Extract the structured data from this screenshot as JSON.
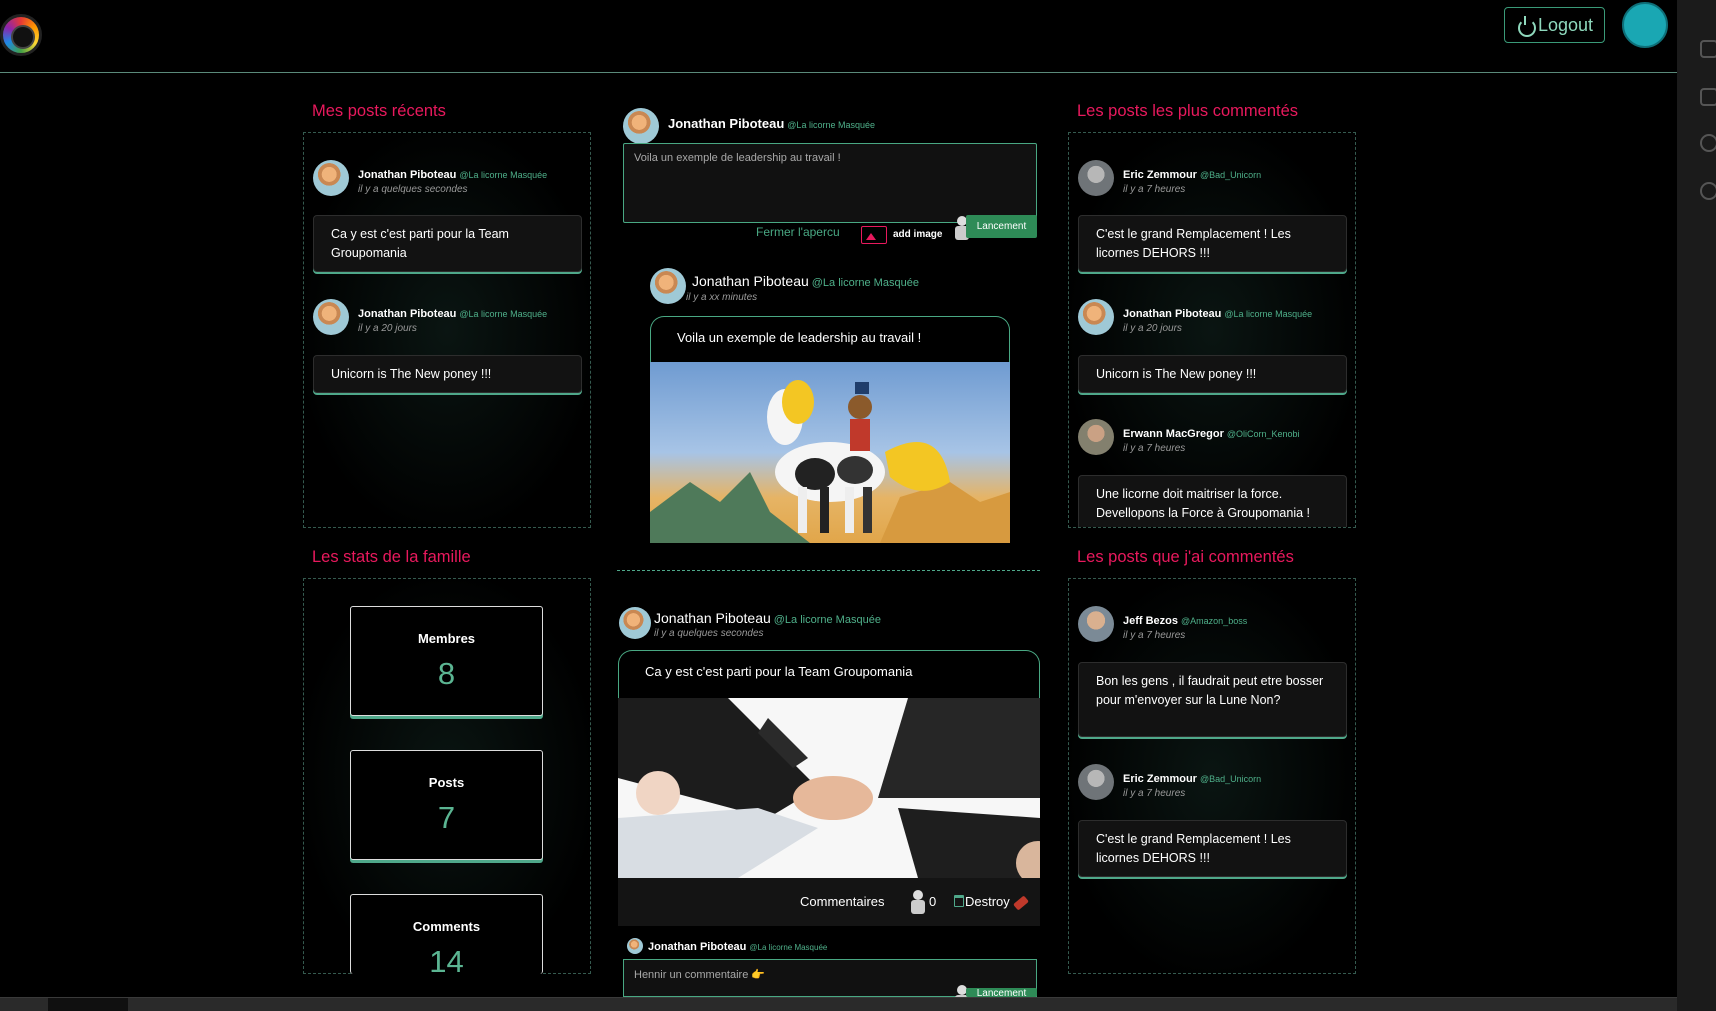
{
  "header": {
    "logout_label": "Logout"
  },
  "titles": {
    "recent": "Mes posts récents",
    "stats": "Les stats de la famille",
    "most_commented": "Les posts les plus commentés",
    "my_comments": "Les posts que j'ai commentés"
  },
  "recent_posts": [
    {
      "name": "Jonathan Piboteau",
      "handle": "@La licorne Masquée",
      "time": "il y a quelques secondes",
      "text": "Ca y est c'est parti pour la Team Groupomania"
    },
    {
      "name": "Jonathan Piboteau",
      "handle": "@La licorne Masquée",
      "time": "il y a 20 jours",
      "text": "Unicorn is The New poney !!!"
    }
  ],
  "stats": [
    {
      "label": "Membres",
      "value": "8"
    },
    {
      "label": "Posts",
      "value": "7"
    },
    {
      "label": "Comments",
      "value": "14"
    }
  ],
  "compose": {
    "name": "Jonathan Piboteau",
    "handle": "@La licorne Masquée",
    "text": "Voila un exemple de leadership au travail !",
    "close_preview": "Fermer l'apercu",
    "add_image": "add image",
    "launch": "Lancement"
  },
  "preview": {
    "name": "Jonathan Piboteau",
    "handle": "@La licorne Masquée",
    "time": "il y a xx minutes",
    "text": "Voila un exemple de leadership au travail !"
  },
  "feed_post": {
    "name": "Jonathan Piboteau",
    "handle": "@La licorne Masquée",
    "time": "il y a quelques secondes",
    "text": "Ca y est c'est parti pour la Team Groupomania",
    "comments_label": "Commentaires",
    "count": "0",
    "destroy_label": "Destroy"
  },
  "comment_form": {
    "name": "Jonathan Piboteau",
    "handle": "@La licorne Masquée",
    "placeholder": "Hennir un commentaire 👉",
    "launch": "Lancement"
  },
  "most_commented": [
    {
      "name": "Eric Zemmour",
      "handle": "@Bad_Unicorn",
      "time": "il y a 7 heures",
      "text": "C'est le grand Remplacement ! Les licornes DEHORS !!!"
    },
    {
      "name": "Jonathan Piboteau",
      "handle": "@La licorne Masquée",
      "time": "il y a 20 jours",
      "text": "Unicorn is The New poney !!!"
    },
    {
      "name": "Erwann MacGregor",
      "handle": "@OliCorn_Kenobi",
      "time": "il y a 7 heures",
      "text": "Une licorne doit maitriser la force. Devellopons la Force à Groupomania !"
    }
  ],
  "my_comments": [
    {
      "name": "Jeff Bezos",
      "handle": "@Amazon_boss",
      "time": "il y a 7 heures",
      "text": "Bon les gens , il faudrait peut etre bosser pour m'envoyer sur la Lune Non?"
    },
    {
      "name": "Eric Zemmour",
      "handle": "@Bad_Unicorn",
      "time": "il y a 7 heures",
      "text": "C'est le grand Remplacement ! Les licornes DEHORS !!!"
    }
  ]
}
